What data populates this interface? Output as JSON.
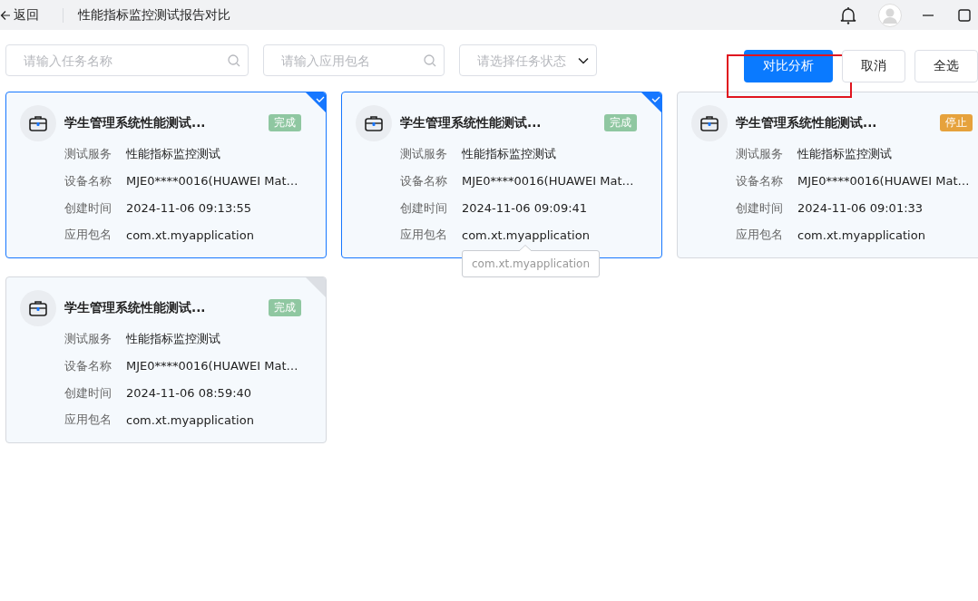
{
  "header": {
    "back_label": "返回",
    "title": "性能指标监控测试报告对比"
  },
  "filters": [
    {
      "kind": "search",
      "placeholder": "请输入任务名称"
    },
    {
      "kind": "search",
      "placeholder": "请输入应用包名"
    },
    {
      "kind": "select",
      "placeholder": "请选择任务状态"
    }
  ],
  "actions": [
    {
      "kind": "primary",
      "label": "对比分析",
      "highlighted": true
    },
    {
      "kind": "default",
      "label": "取消",
      "highlighted": false
    },
    {
      "kind": "default",
      "label": "全选",
      "highlighted": false
    }
  ],
  "cards": [
    {
      "title": "学生管理系统性能测试...",
      "status": "完成",
      "color": "#8fc7a1",
      "selected": true,
      "fields": [
        {
          "label": "测试服务",
          "value": "性能指标监控测试"
        },
        {
          "label": "设备名称",
          "value": "MJE0****0016(HUAWEI Mat…"
        },
        {
          "label": "创建时间",
          "value": "2024-11-06 09:13:55"
        },
        {
          "label": "应用包名",
          "value": "com.xt.myapplication"
        }
      ]
    },
    {
      "title": "学生管理系统性能测试...",
      "status": "完成",
      "color": "#8fc7a1",
      "selected": true,
      "tooltip": "com.xt.myapplication",
      "fields": [
        {
          "label": "测试服务",
          "value": "性能指标监控测试"
        },
        {
          "label": "设备名称",
          "value": "MJE0****0016(HUAWEI Mat…"
        },
        {
          "label": "创建时间",
          "value": "2024-11-06 09:09:41"
        },
        {
          "label": "应用包名",
          "value": "com.xt.myapplication"
        }
      ]
    },
    {
      "title": "学生管理系统性能测试...",
      "status": "停止",
      "color": "#e6a23c",
      "selected": false,
      "fields": [
        {
          "label": "测试服务",
          "value": "性能指标监控测试"
        },
        {
          "label": "设备名称",
          "value": "MJE0****0016(HUAWEI Mat…"
        },
        {
          "label": "创建时间",
          "value": "2024-11-06 09:01:33"
        },
        {
          "label": "应用包名",
          "value": "com.xt.myapplication"
        }
      ]
    },
    {
      "title": "学生管理系统性能测试...",
      "status": "完成",
      "color": "#8fc7a1",
      "selected": false,
      "fields": [
        {
          "label": "测试服务",
          "value": "性能指标监控测试"
        },
        {
          "label": "设备名称",
          "value": "MJE0****0016(HUAWEI Mat…"
        },
        {
          "label": "创建时间",
          "value": "2024-11-06 08:59:40"
        },
        {
          "label": "应用包名",
          "value": "com.xt.myapplication"
        }
      ]
    }
  ]
}
